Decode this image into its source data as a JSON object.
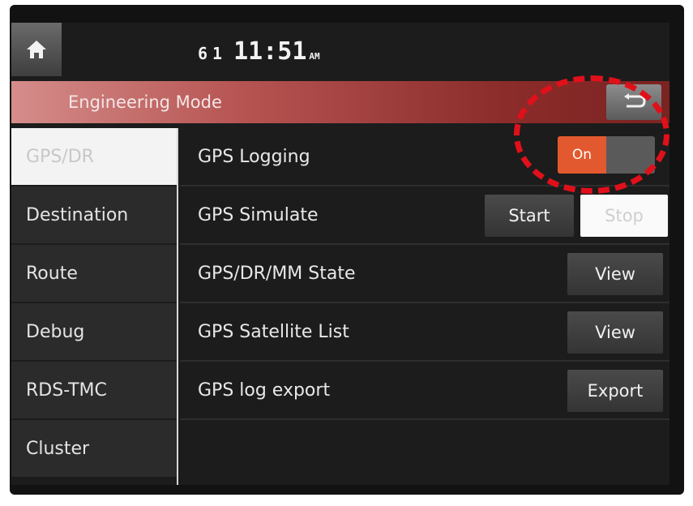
{
  "status": {
    "indicator1": "6",
    "indicator2": "1",
    "time": "11:51",
    "ampm": "AM"
  },
  "title": "Engineering Mode",
  "sidebar": {
    "items": [
      {
        "label": "GPS/DR",
        "active": true
      },
      {
        "label": "Destination"
      },
      {
        "label": "Route"
      },
      {
        "label": "Debug"
      },
      {
        "label": "RDS-TMC"
      },
      {
        "label": "Cluster"
      }
    ]
  },
  "rows": [
    {
      "label": "GPS Logging",
      "toggle_label": "On",
      "toggle_state": "on"
    },
    {
      "label": "GPS Simulate",
      "start_label": "Start",
      "stop_label": "Stop"
    },
    {
      "label": "GPS/DR/MM State",
      "button_label": "View"
    },
    {
      "label": "GPS Satellite List",
      "button_label": "View"
    },
    {
      "label": "GPS log export",
      "button_label": "Export"
    }
  ],
  "colors": {
    "toggle_on": "#e3592f",
    "annotation": "#e0101a",
    "title_bar": "#b65452"
  },
  "icons": {
    "home": "home-icon",
    "back": "back-arrow-icon"
  }
}
